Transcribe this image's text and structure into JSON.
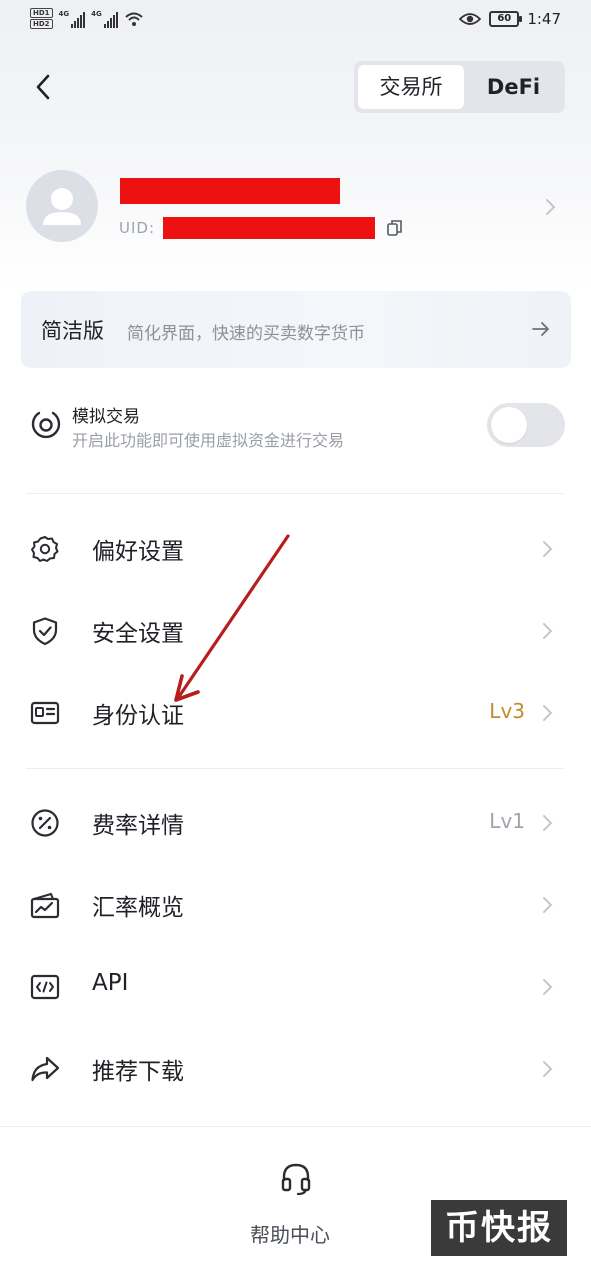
{
  "status_bar": {
    "network_1": "4G",
    "network_2": "4G",
    "battery": "60",
    "time": "1:47"
  },
  "header": {
    "tabs": [
      {
        "label": "交易所",
        "active": true
      },
      {
        "label": "DeFi",
        "active": false
      }
    ]
  },
  "profile": {
    "uid_label": "UID:"
  },
  "simple_version": {
    "title": "简洁版",
    "description": "简化界面，快速的买卖数字货币"
  },
  "simulated_trading": {
    "title": "模拟交易",
    "description": "开启此功能即可使用虚拟资金进行交易",
    "enabled": false
  },
  "menu": [
    {
      "label": "偏好设置",
      "value": "",
      "icon": "gear-icon"
    },
    {
      "label": "安全设置",
      "value": "",
      "icon": "shield-icon"
    },
    {
      "label": "身份认证",
      "value": "Lv3",
      "icon": "id-card-icon"
    },
    {
      "label": "费率详情",
      "value": "Lv1",
      "icon": "percent-icon"
    },
    {
      "label": "汇率概览",
      "value": "",
      "icon": "wallet-chart-icon"
    },
    {
      "label": "API",
      "value": "",
      "icon": "code-icon"
    },
    {
      "label": "推荐下载",
      "value": "",
      "icon": "share-icon"
    }
  ],
  "bottom": {
    "help_label": "帮助中心"
  },
  "watermark": "币快报",
  "colors": {
    "accent_gold": "#c48a2e",
    "muted": "#a0a4ad",
    "redaction": "#ee1111",
    "annotation_arrow": "#b81d1d"
  }
}
